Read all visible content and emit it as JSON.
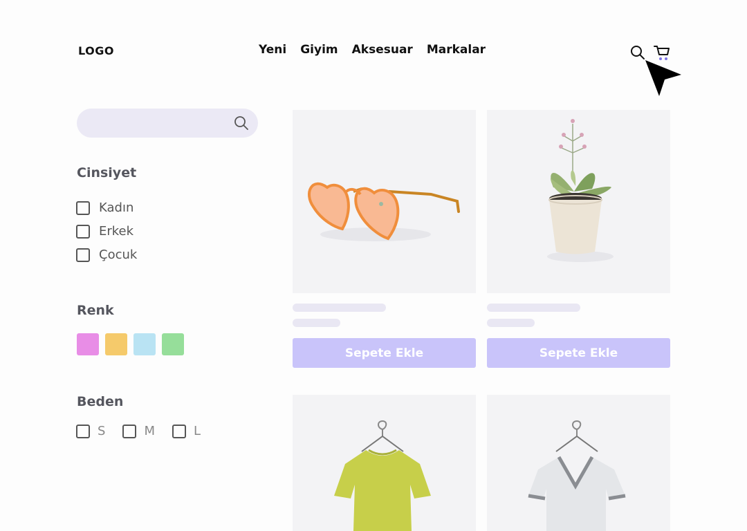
{
  "header": {
    "logo": "LOGO",
    "nav": [
      "Yeni",
      "Giyim",
      "Aksesuar",
      "Markalar"
    ]
  },
  "sidebar": {
    "search_placeholder": "",
    "gender": {
      "title": "Cinsiyet",
      "options": [
        "Kadın",
        "Erkek",
        "Çocuk"
      ]
    },
    "color": {
      "title": "Renk",
      "swatches": [
        "#e88de6",
        "#f5ca6b",
        "#b9e3f3",
        "#96de9a"
      ]
    },
    "size": {
      "title": "Beden",
      "options": [
        "S",
        "M",
        "L"
      ]
    }
  },
  "products": [
    {
      "image": "heart-sunglasses",
      "button": "Sepete Ekle"
    },
    {
      "image": "potted-succulent",
      "button": "Sepete Ekle"
    },
    {
      "image": "yellow-tshirt-on-hanger",
      "button": ""
    },
    {
      "image": "white-vneck-tshirt-on-hanger",
      "button": ""
    }
  ],
  "colors": {
    "accent": "#c9c4fa",
    "skeleton": "#e9e7f3",
    "search_bg": "#ebe9f5"
  }
}
